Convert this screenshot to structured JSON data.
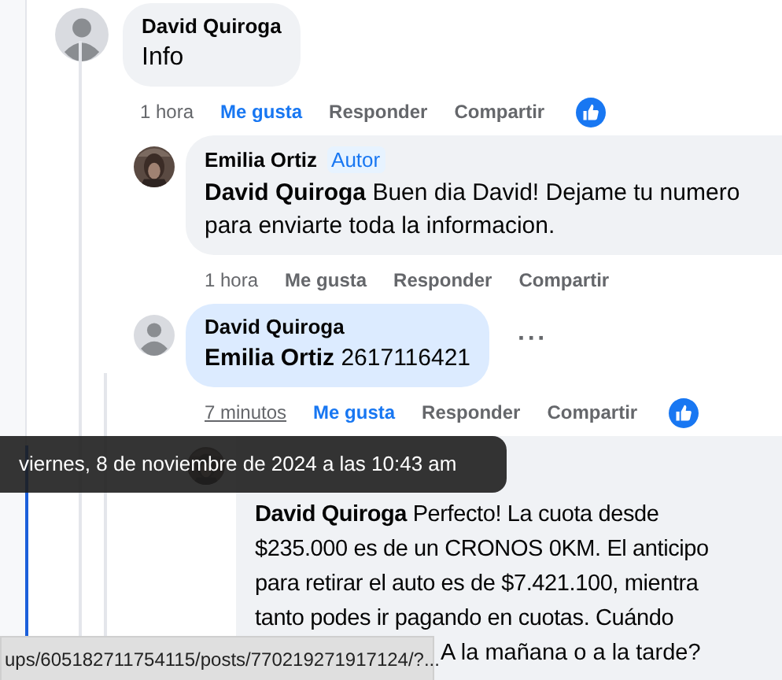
{
  "comments": [
    {
      "author": "David Quiroga",
      "avatar": {
        "kind": "silhouette"
      },
      "highlighted": false,
      "text": "Info",
      "time": "1 hora",
      "time_hovered": false,
      "liked": true,
      "reaction": true,
      "actions": [
        "Me gusta",
        "Responder",
        "Compartir"
      ],
      "children": [
        {
          "author": "Emilia Ortiz",
          "badge": "Autor",
          "highlighted": false,
          "text": "**David Quiroga** Buen dia David! Dejame tu numero\npara enviarte toda la informacion.",
          "time": "1 hora",
          "time_hovered": false,
          "liked": false,
          "reaction": false,
          "actions": [
            "Me gusta",
            "Responder",
            "Compartir"
          ]
        },
        {
          "author": "David Quiroga",
          "avatar": {
            "kind": "silhouette"
          },
          "highlighted": true,
          "text": "**Emilia Ortiz** 2617116421",
          "time": "7 minutos",
          "time_hovered": true,
          "liked": true,
          "reaction": true,
          "more_button": "···",
          "actions": [
            "Me gusta",
            "Responder",
            "Compartir"
          ],
          "children": [
            {
              "highlighted": false,
              "text": "**David Quiroga** Perfecto! La cuota desde\n$235.000 es de un CRONOS 0KM. El anticipo\npara retirar el auto es de $7.421.100, mientra\ntanto podes ir pagando en cuotas. Cuándo",
              "text_tail": "A la mañana o a la tarde?"
            }
          ]
        }
      ]
    }
  ],
  "tooltip": {
    "text": "viernes, 8 de noviembre de 2024 a las 10:43 am"
  },
  "status_bar": {
    "url": "ups/605182711754115/posts/770219271917124/?..."
  }
}
